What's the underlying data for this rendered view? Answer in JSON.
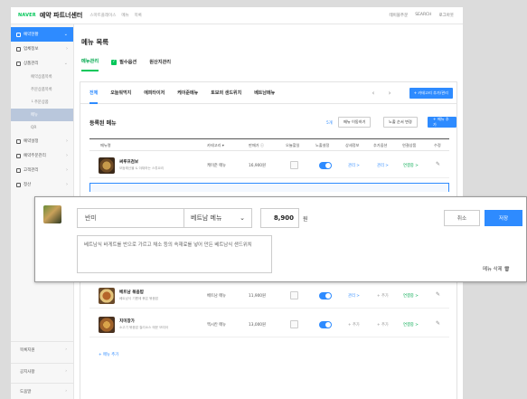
{
  "header": {
    "brand": "NAVER",
    "title": "예약 파트너센터",
    "crumbs": [
      "스마트플레이스",
      "메뉴",
      "목록"
    ],
    "right_items": [
      "테이블주문",
      "SEARCH",
      "로그아웃"
    ]
  },
  "sidebar": {
    "items": [
      {
        "label": "예약현황",
        "active": true
      },
      {
        "label": "업체정보",
        "active": false
      },
      {
        "label": "상품관리",
        "active": false
      }
    ],
    "subitems": [
      {
        "label": "예약상품목록",
        "state": "normal"
      },
      {
        "label": "주문상품목록",
        "state": "normal"
      },
      {
        "label": "└ 주문상품",
        "state": "normal"
      },
      {
        "label": "메뉴",
        "state": "highlight"
      },
      {
        "label": "QR",
        "state": "normal"
      }
    ],
    "items2": [
      {
        "label": "예약설정"
      },
      {
        "label": "예약주문관리"
      },
      {
        "label": "고객관리"
      },
      {
        "label": "정산"
      }
    ],
    "bottom": [
      "목록지원",
      "공지사항",
      "도움말"
    ]
  },
  "page": {
    "title": "메뉴 목록",
    "tabs": [
      {
        "label": "메뉴관리",
        "active": true,
        "check": false
      },
      {
        "label": "필수옵션",
        "active": false,
        "check": true
      },
      {
        "label": "원산지관리",
        "active": false,
        "check": false
      }
    ]
  },
  "categories": {
    "tabs": [
      "전체",
      "오늘뭐먹지",
      "에피타이저",
      "케이준메뉴",
      "토보의 샌드위치",
      "베트남메뉴"
    ],
    "prev": "‹",
    "next": "›",
    "add_label": "+ 카테고리 추가/관리"
  },
  "list": {
    "title": "등록된 메뉴",
    "count": "5개",
    "buttons": {
      "move": "메뉴 이동하기",
      "order": "노출 순서 변경",
      "add": "+ 메뉴 추가"
    },
    "headers": [
      "메뉴명",
      "카테고리 ▾",
      "판매가 ⓘ",
      "오늘할일",
      "노출설정",
      "상세정보",
      "추가옵션",
      "연결상품",
      "수정"
    ],
    "rows": [
      {
        "name": "써루프검보",
        "desc": "모둠해산물 & 야채하는 스튜요리",
        "category": "케이준 메뉴",
        "price": "16,900원",
        "detail": "관리 >",
        "option": "관리 >",
        "linked": "연결중 >",
        "option_gray": false
      },
      {
        "name": "베트남 볶음밥",
        "desc": "베트남식 기름에 볶은 볶음밥",
        "category": "베트남 메뉴",
        "price": "11,900원",
        "detail": "관리 >",
        "option": "+ 추가",
        "linked": "연결중 >",
        "option_gray": true
      },
      {
        "name": "치미창가",
        "desc": "소고기 볶음밥 칠리소스 매운 또띠아",
        "category": "멕시칸 메뉴",
        "price": "13,000원",
        "detail": "+ 추가",
        "option": "+ 추가",
        "linked": "연결중 >",
        "option_gray": true
      }
    ],
    "add_menu": "+ 메뉴 추가"
  },
  "edit_popup": {
    "name_value": "반미",
    "category_value": "베트남 메뉴",
    "price_value": "8,900",
    "price_unit": "원",
    "description": "베트남식 바게트를 반으로 가르고 채소 등의 속재료를 넣어 만든 베트남식 샌드위치",
    "cancel": "취소",
    "save": "저장",
    "delete": "메뉴 삭제 ",
    "trash_icon": "trash-icon"
  }
}
